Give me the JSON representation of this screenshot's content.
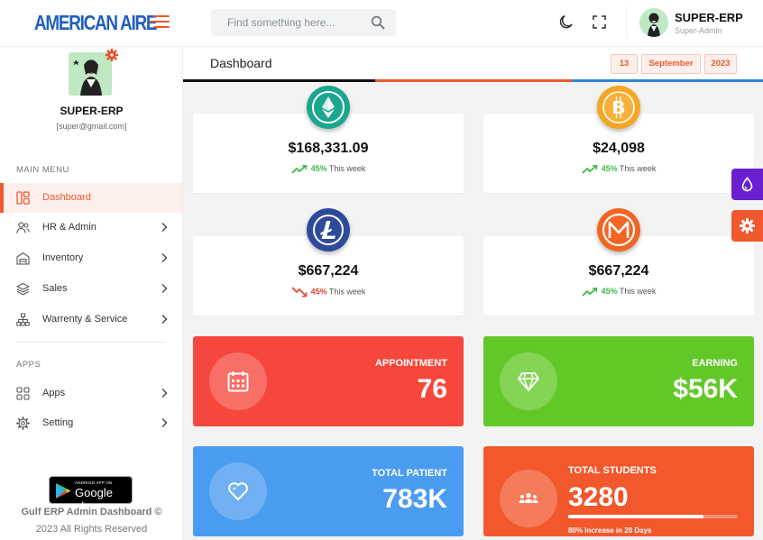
{
  "brand": {
    "logo": "AMERICAN AIRE",
    "accent": "#f0582e",
    "blue": "#1f5fbf"
  },
  "header": {
    "search_placeholder": "Find something here...",
    "user": {
      "name": "SUPER-ERP",
      "role": "Super-Admin"
    },
    "icons": [
      "moon-icon",
      "fullscreen-icon",
      "search-icon",
      "hamburger-icon"
    ]
  },
  "sidebar": {
    "profile": {
      "name": "SUPER-ERP",
      "email": "[super@gmail.com]"
    },
    "main_menu_title": "MAIN MENU",
    "main_items": [
      {
        "label": "Dashboard",
        "icon": "dashboard-icon",
        "active": true
      },
      {
        "label": "HR & Admin",
        "icon": "users-icon"
      },
      {
        "label": "Inventory",
        "icon": "warehouse-icon"
      },
      {
        "label": "Sales",
        "icon": "layers-icon"
      },
      {
        "label": "Warrenty & Service",
        "icon": "hierarchy-icon"
      }
    ],
    "apps_title": "APPS",
    "app_items": [
      {
        "label": "Apps",
        "icon": "grid-icon"
      },
      {
        "label": "Setting",
        "icon": "gear-icon"
      }
    ],
    "google_play": {
      "small": "ANDROID APP ON",
      "big": "Google play"
    },
    "footer": {
      "line1": "Gulf ERP Admin Dashboard ©",
      "line2": "2023 All Rights Reserved"
    }
  },
  "page": {
    "title": "Dashboard",
    "date": {
      "day": "13",
      "month": "September",
      "year": "2023"
    }
  },
  "crypto_cards": [
    {
      "coin": "ethereum-icon",
      "color": "#1aa68f",
      "amount": "$168,331.09",
      "pct": "45%",
      "period": "This week",
      "trend": "up"
    },
    {
      "coin": "bitcoin-icon",
      "color": "#f5a623",
      "amount": "$24,098",
      "pct": "45%",
      "period": "This week",
      "trend": "up"
    },
    {
      "coin": "litecoin-icon",
      "color": "#2e4a9a",
      "amount": "$667,224",
      "pct": "45%",
      "period": "This week",
      "trend": "down"
    },
    {
      "coin": "monero-icon",
      "color": "#f26522",
      "amount": "$667,224",
      "pct": "45%",
      "period": "This week",
      "trend": "up"
    }
  ],
  "stat_cards": {
    "appointment": {
      "label": "APPOINTMENT",
      "value": "76",
      "color": "#f7473d"
    },
    "earning": {
      "label": "EARNING",
      "value": "$56K",
      "color": "#62c827"
    },
    "total_patient": {
      "label": "TOTAL PATIENT",
      "value": "783K",
      "color": "#4a9cf0"
    },
    "total_students": {
      "label": "TOTAL STUDENTS",
      "value": "3280",
      "color": "#f2582c",
      "progress": 80,
      "note": "80% Increase in 20 Days"
    }
  }
}
